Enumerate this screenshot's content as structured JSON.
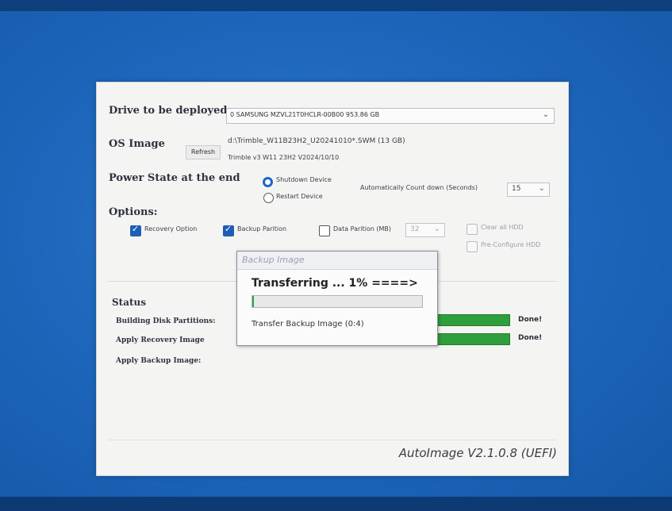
{
  "drive": {
    "label": "Drive to be deployed",
    "value": "0 SAMSUNG MZVL21T0HCLR-00B00 953.86 GB"
  },
  "os_image": {
    "label": "OS Image",
    "refresh_label": "Refresh",
    "path": "d:\\Trimble_W11B23H2_U20241010*.SWM  (13 GB)",
    "description": "Trimble v3 W11 23H2 V2024/10/10"
  },
  "power_state": {
    "label": "Power State at the end",
    "shutdown_label": "Shutdown Device",
    "restart_label": "Restart Device",
    "selected": "Shutdown Device",
    "countdown_label": "Automatically Count down (Seconds)",
    "countdown_value": "15"
  },
  "options": {
    "label": "Options:",
    "recovery_label": "Recovery Option",
    "backup_label": "Backup Parition",
    "data_label": "Data Parition (MB)",
    "data_size": "32",
    "clear_hdd_label": "Clear all HDD",
    "preconfig_label": "Pre-Configure HDD",
    "recovery_checked": true,
    "backup_checked": true,
    "data_checked": false
  },
  "status": {
    "label": "Status",
    "rows": [
      {
        "label": "Building Disk Partitions:",
        "state": "Done!",
        "progress": 1.0
      },
      {
        "label": "Apply Recovery Image",
        "state": "Done!",
        "progress": 1.0
      },
      {
        "label": "Apply Backup Image:",
        "state": "",
        "progress": 0.0
      }
    ]
  },
  "dialog": {
    "title": "Backup Image",
    "heading": "Transferring ... 1% ====>",
    "progress": 0.01,
    "message": "Transfer Backup Image  (0:4)"
  },
  "footer": {
    "version": "AutoImage V2.1.0.8 (UEFI)"
  },
  "colors": {
    "accent": "#1f5db8",
    "progress_green": "#2f9e3c",
    "desktop": "#1a5fb0"
  },
  "icons": {
    "dropdown": "chevron-down-icon",
    "checkbox": "checkmark-icon"
  }
}
